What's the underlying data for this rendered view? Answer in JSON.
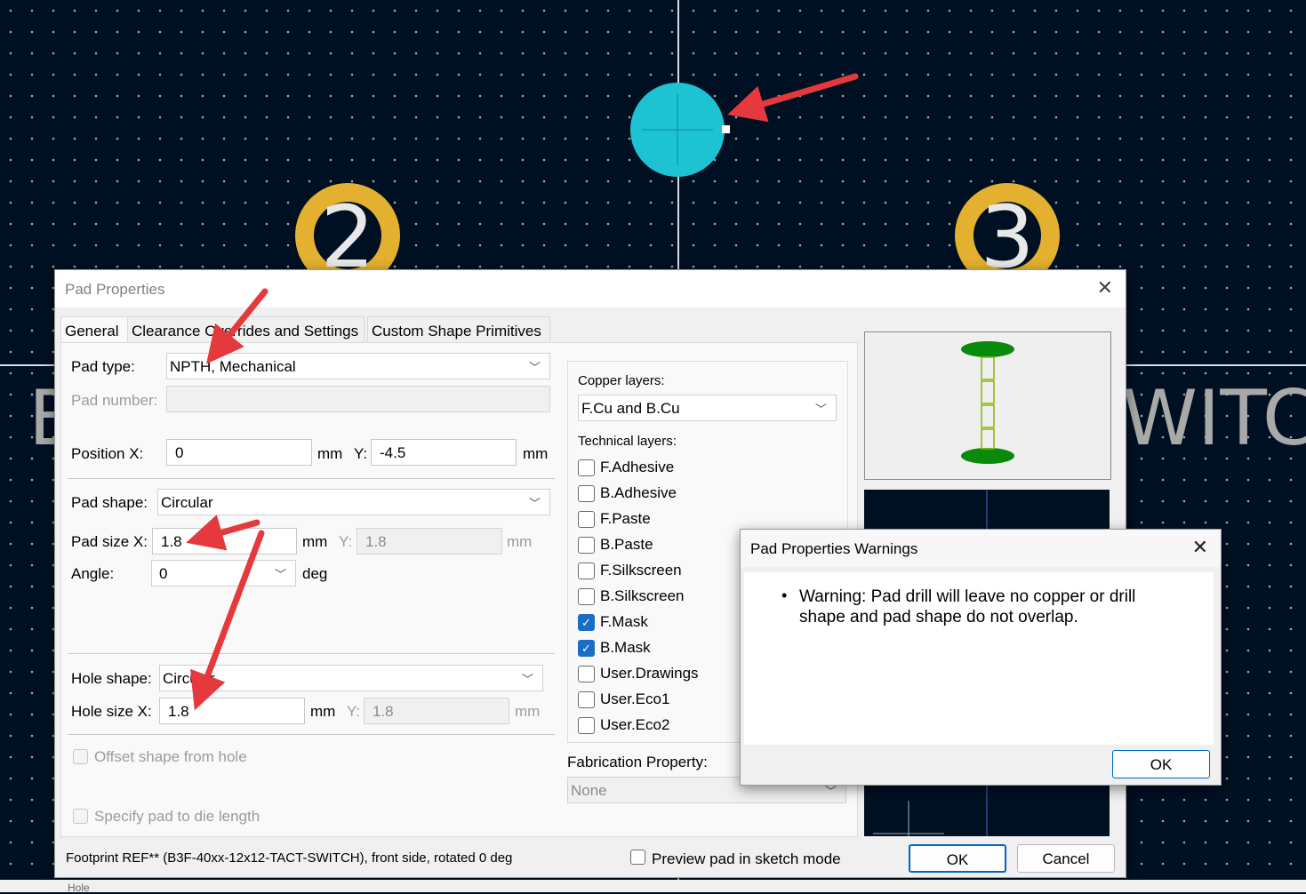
{
  "canvas": {
    "pad2_number": "2",
    "pad3_number": "3",
    "silk_text_left": "B",
    "silk_text_right": "WITCH",
    "bottom_text": "Hole"
  },
  "dialog": {
    "title": "Pad Properties",
    "tabs": [
      "General",
      "Clearance Overrides and Settings",
      "Custom Shape Primitives"
    ],
    "pad_type": {
      "label": "Pad type:",
      "value": "NPTH, Mechanical"
    },
    "pad_number": {
      "label": "Pad number:",
      "value": ""
    },
    "position": {
      "label_x": "Position X:",
      "x": "0",
      "unit_x": "mm",
      "label_y": "Y:",
      "y": "-4.5",
      "unit_y": "mm"
    },
    "pad_shape": {
      "label": "Pad shape:",
      "value": "Circular"
    },
    "pad_size": {
      "label_x": "Pad size X:",
      "x": "1.8",
      "unit_x": "mm",
      "label_y": "Y:",
      "y": "1.8",
      "unit_y": "mm"
    },
    "angle": {
      "label": "Angle:",
      "value": "0",
      "unit": "deg"
    },
    "hole_shape": {
      "label": "Hole shape:",
      "value": "Circular"
    },
    "hole_size": {
      "label_x": "Hole size X:",
      "x": "1.8",
      "unit_x": "mm",
      "label_y": "Y:",
      "y": "1.8",
      "unit_y": "mm"
    },
    "offset_shape": "Offset shape from hole",
    "die_length": "Specify pad to die length",
    "copper_layers": {
      "label": "Copper layers:",
      "value": "F.Cu and B.Cu"
    },
    "technical_layers_label": "Technical layers:",
    "technical_layers": [
      {
        "name": "F.Adhesive",
        "checked": false
      },
      {
        "name": "B.Adhesive",
        "checked": false
      },
      {
        "name": "F.Paste",
        "checked": false
      },
      {
        "name": "B.Paste",
        "checked": false
      },
      {
        "name": "F.Silkscreen",
        "checked": false
      },
      {
        "name": "B.Silkscreen",
        "checked": false
      },
      {
        "name": "F.Mask",
        "checked": true
      },
      {
        "name": "B.Mask",
        "checked": true
      },
      {
        "name": "User.Drawings",
        "checked": false
      },
      {
        "name": "User.Eco1",
        "checked": false
      },
      {
        "name": "User.Eco2",
        "checked": false
      }
    ],
    "fabrication": {
      "label": "Fabrication Property:",
      "value": "None"
    },
    "footer_text": "Footprint REF** (B3F-40xx-12x12-TACT-SWITCH), front side, rotated 0 deg",
    "preview_sketch": "Preview pad in sketch mode",
    "ok": "OK",
    "cancel": "Cancel"
  },
  "warning": {
    "title": "Pad Properties Warnings",
    "message": "Warning: Pad drill will leave no copper or drill shape and pad shape do not overlap.",
    "ok": "OK"
  },
  "colors": {
    "canvas_bg": "#001023",
    "pad_cyan": "#1ec3d3",
    "pad_gold": "#e3b02f",
    "arrow_red": "#e5393d",
    "preview_green": "#0a8a0a",
    "accent_blue": "#0067c0"
  }
}
